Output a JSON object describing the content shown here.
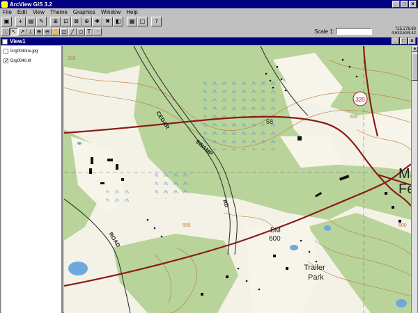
{
  "app": {
    "title": "ArcView GIS 3.2"
  },
  "window_buttons": {
    "minimize": "_",
    "maximize": "□",
    "close": "×"
  },
  "menu": [
    "File",
    "Edit",
    "View",
    "Theme",
    "Graphics",
    "Window",
    "Help"
  ],
  "scale": {
    "label": "Scale 1:",
    "value": ""
  },
  "coordinates": {
    "x": "725,278.80",
    "y": "4,633,634.42"
  },
  "view": {
    "title": "View1",
    "themes": [
      {
        "name": "Drg0040ne.jpg",
        "checked": false
      },
      {
        "name": "Drg0040.tif",
        "checked": true
      }
    ]
  },
  "map_labels": {
    "cedar": "CEDAR",
    "swamp": "SWAMP",
    "rd": "RD",
    "road": "ROAD",
    "route": "320",
    "bm": "BM",
    "bm_elev": "600",
    "trailer": "Trailer",
    "park": "Park",
    "town_a": "Ma",
    "town_b": "Fe",
    "elev_58": "58",
    "elev_550": "550",
    "elev_600": "600"
  },
  "colors": {
    "title_bar": "#000080",
    "chrome": "#c0c0c0",
    "map_green": "#b9d49a",
    "map_road": "#8b1a1a",
    "contour": "#b8763a"
  },
  "icons": {
    "toolbar1": [
      "save-icon",
      "add-theme-icon",
      "theme-properties-icon",
      "edit-legend-icon",
      "query-builder-icon",
      "zoom-full-extent-icon",
      "zoom-to-themes-icon",
      "zoom-to-selected-icon",
      "zoom-in-fixed-icon",
      "zoom-out-fixed-icon",
      "zoom-previous-icon",
      "select-by-theme-icon",
      "clear-selection-icon",
      "table-icon",
      "help-icon"
    ],
    "toolbar2": [
      "info-icon",
      "pointer-icon",
      "vertex-icon",
      "measure-icon",
      "zoom-in-icon",
      "zoom-out-icon",
      "pan-icon",
      "label-icon",
      "text-icon",
      "draw-icon",
      "circle-icon",
      "text-tool-icon",
      "snap-icon"
    ]
  }
}
